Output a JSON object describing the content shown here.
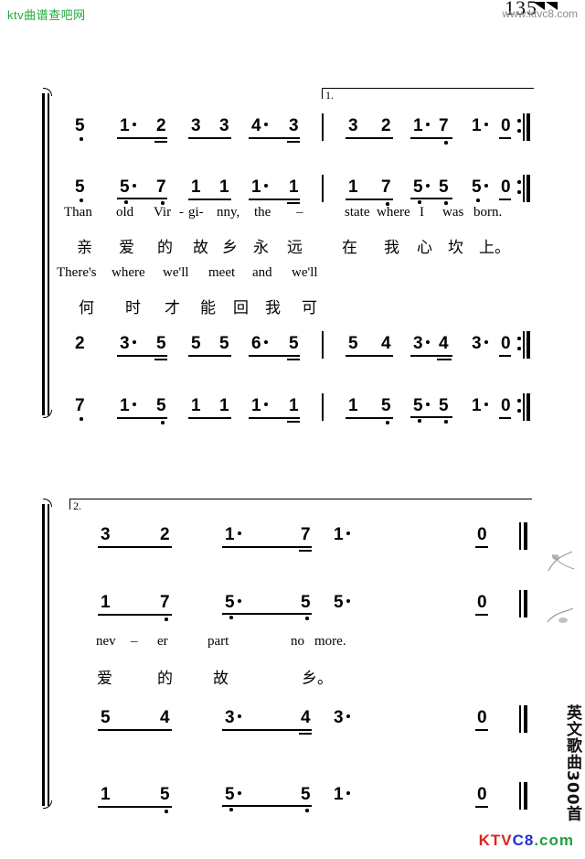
{
  "header": {
    "site_logo": "ktv曲谱查吧网",
    "page_number": "135",
    "site_url": "www.ktvc8.com"
  },
  "footer": {
    "watermark_parts": [
      "KTV",
      "C8",
      ".com"
    ]
  },
  "book_title_vertical": "英文歌曲300首",
  "systems": [
    {
      "id": "system-1",
      "volta": {
        "label": "1."
      },
      "staves": [
        {
          "id": "s1-voice1",
          "notes": [
            "5",
            "1",
            "2",
            "3",
            "3",
            "4",
            "3",
            "3",
            "2",
            "1",
            "7",
            "1",
            "0"
          ]
        },
        {
          "id": "s1-voice2",
          "notes": [
            "5",
            "5",
            "7",
            "1",
            "1",
            "1",
            "1",
            "1",
            "7",
            "5",
            "5",
            "5",
            "0"
          ]
        },
        {
          "id": "s1-voice3",
          "notes": [
            "2",
            "3",
            "5",
            "5",
            "5",
            "6",
            "5",
            "5",
            "4",
            "3",
            "4",
            "3",
            "0"
          ]
        },
        {
          "id": "s1-voice4",
          "notes": [
            "7",
            "1",
            "5",
            "1",
            "1",
            "1",
            "1",
            "1",
            "5",
            "5",
            "5",
            "1",
            "0"
          ]
        }
      ],
      "lyrics": [
        {
          "id": "s1-lyric-en-1",
          "lang": "en",
          "words": [
            "Than",
            "old",
            "Vir",
            "-",
            "gi-",
            "nny,",
            "the",
            "–",
            "state",
            "where",
            "I",
            "was",
            "born."
          ]
        },
        {
          "id": "s1-lyric-cn-1",
          "lang": "cn",
          "words": [
            "亲",
            "爱",
            "的",
            "故",
            "乡",
            "永",
            "远",
            "在",
            "我",
            "心",
            "坎",
            "上。"
          ]
        },
        {
          "id": "s1-lyric-en-2",
          "lang": "en",
          "words": [
            "There's",
            "where",
            "we'll",
            "meet",
            "and",
            "we'll"
          ]
        },
        {
          "id": "s1-lyric-cn-2",
          "lang": "cn",
          "words": [
            "何",
            "时",
            "才",
            "能",
            "回",
            "我",
            "可"
          ]
        }
      ]
    },
    {
      "id": "system-2",
      "volta": {
        "label": "2."
      },
      "staves": [
        {
          "id": "s2-voice1",
          "notes": [
            "3",
            "2",
            "1",
            "7",
            "1",
            "0"
          ]
        },
        {
          "id": "s2-voice2",
          "notes": [
            "1",
            "7",
            "5",
            "5",
            "5",
            "0"
          ]
        },
        {
          "id": "s2-voice3",
          "notes": [
            "5",
            "4",
            "3",
            "4",
            "3",
            "0"
          ]
        },
        {
          "id": "s2-voice4",
          "notes": [
            "1",
            "5",
            "5",
            "5",
            "1",
            "0"
          ]
        }
      ],
      "lyrics": [
        {
          "id": "s2-lyric-en",
          "lang": "en",
          "words": [
            "nev",
            "–",
            "er",
            "part",
            "no",
            "more."
          ]
        },
        {
          "id": "s2-lyric-cn",
          "lang": "cn",
          "words": [
            "爱",
            "的",
            "故",
            "乡。"
          ]
        }
      ]
    }
  ]
}
